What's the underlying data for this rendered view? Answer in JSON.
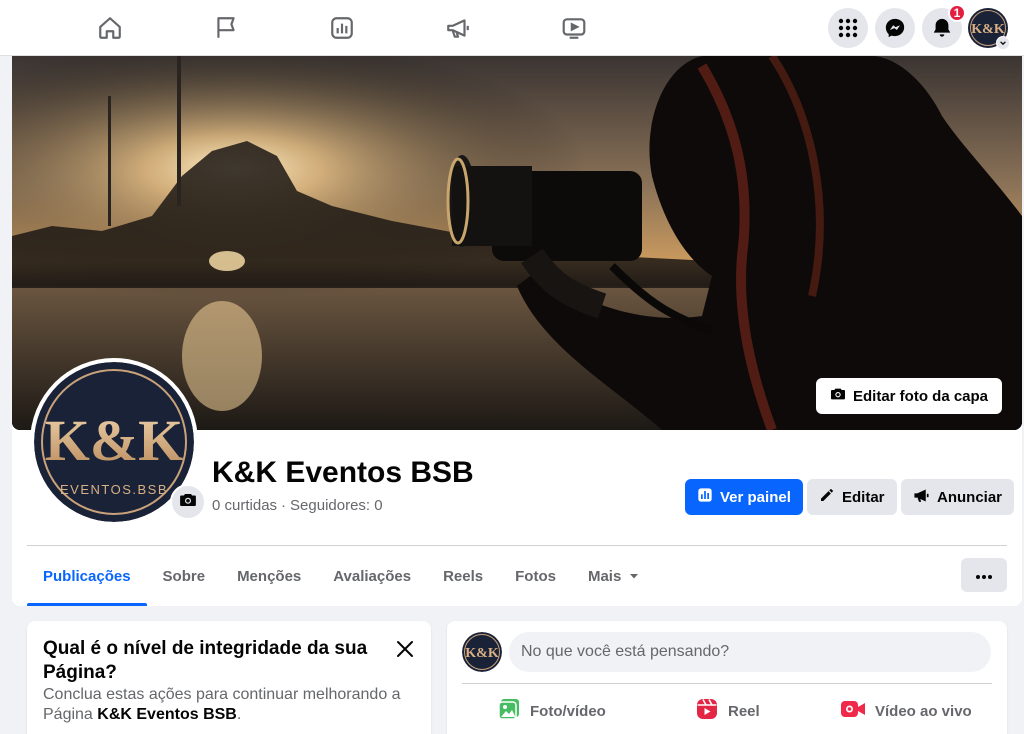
{
  "topnav": {
    "icons": [
      "home-icon",
      "flag-icon",
      "insights-icon",
      "megaphone-icon",
      "video-icon"
    ],
    "menu_icon": "grid-menu-icon",
    "messenger_icon": "messenger-icon",
    "notifications_icon": "bell-icon",
    "notifications_count": "1"
  },
  "cover": {
    "edit_label": "Editar foto da capa"
  },
  "profile": {
    "name": "K&K Eventos BSB",
    "likes": "0 curtidas",
    "separator": "·",
    "followers": "Seguidores: 0",
    "logo_text": "K&K",
    "logo_subtext": "EVENTOS.BSB"
  },
  "actions": {
    "dashboard": "Ver painel",
    "edit": "Editar",
    "advertise": "Anunciar"
  },
  "tabs": [
    {
      "label": "Publicações",
      "active": true
    },
    {
      "label": "Sobre"
    },
    {
      "label": "Menções"
    },
    {
      "label": "Avaliações"
    },
    {
      "label": "Reels"
    },
    {
      "label": "Fotos"
    },
    {
      "label": "Mais"
    }
  ],
  "integrity_card": {
    "title": "Qual é o nível de integridade da sua Página?",
    "desc_prefix": "Conclua estas ações para continuar melhorando a Página ",
    "desc_page": "K&K Eventos BSB",
    "desc_suffix": "."
  },
  "composer": {
    "placeholder": "No que você está pensando?",
    "photo": "Foto/vídeo",
    "reel": "Reel",
    "live": "Vídeo ao vivo"
  },
  "colors": {
    "primary": "#0866ff",
    "photo_green": "#45bd62",
    "reel_pink": "#e42645",
    "live_red": "#f02849",
    "logo_gold": "#d8b083",
    "logo_navy": "#1a2238"
  }
}
